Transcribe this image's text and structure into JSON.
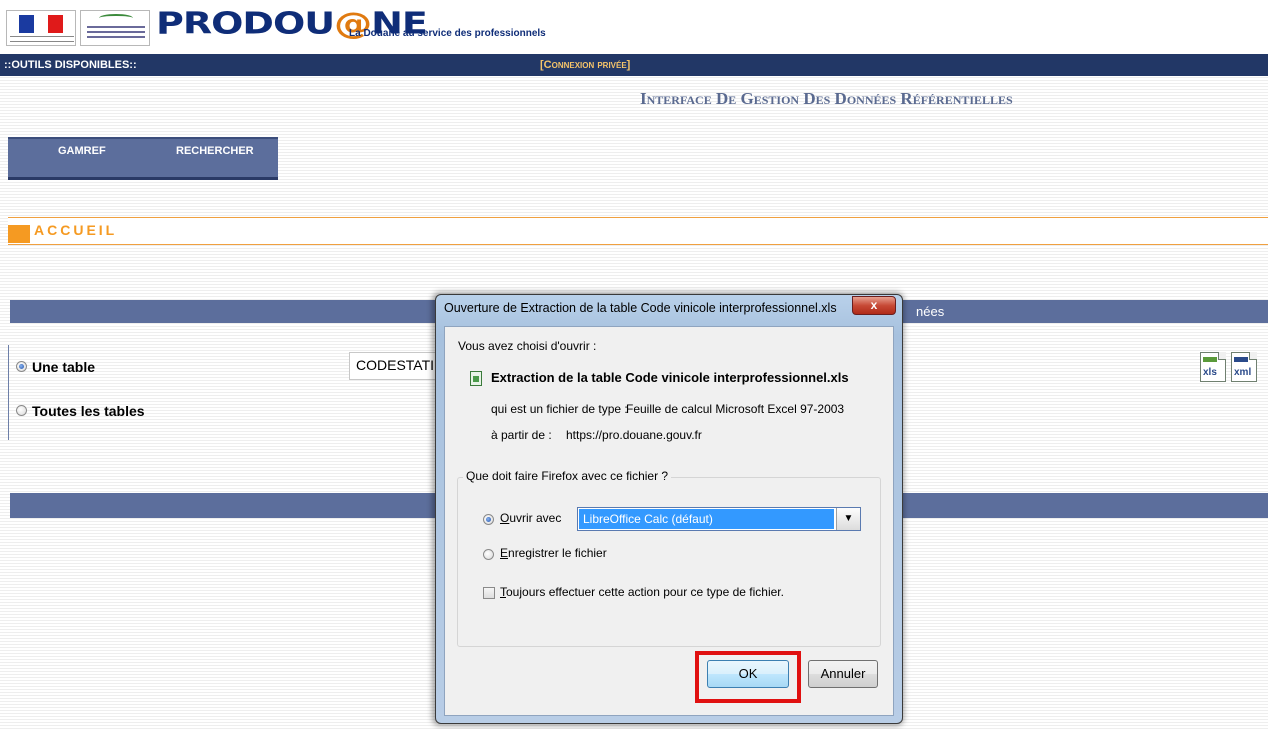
{
  "header": {
    "brand_pre": "PRODOU",
    "brand_at": "@",
    "brand_post": "NE",
    "tagline": "La Douane au service des professionnels",
    "logo_rf_icon": "republique-francaise-logo",
    "logo_ministry_icon": "ministry-logo"
  },
  "topbar": {
    "tools_label": "::OUTILS DISPONIBLES::",
    "private_link": "[Connexion privée]"
  },
  "page_title": "Interface De Gestion Des Données Référentielles",
  "menu": {
    "items": [
      {
        "label": "GAMREF"
      },
      {
        "label": "RECHERCHER"
      }
    ]
  },
  "accueil": {
    "title": "ACCUEIL"
  },
  "section1": {
    "header_visible": "nées",
    "options": [
      {
        "label": "Une table",
        "checked": true
      },
      {
        "label": "Toutes les tables",
        "checked": false
      }
    ],
    "table_value": "CODESTATI",
    "export_icons": [
      {
        "name": "xls-export-icon",
        "text": "xls"
      },
      {
        "name": "xml-export-icon",
        "text": "xml"
      }
    ]
  },
  "dialog": {
    "title": "Ouverture de Extraction de la table Code vinicole interprofessionnel.xls",
    "close_label": "x",
    "chosen_text": "Vous avez choisi d'ouvrir :",
    "file_name": "Extraction de la table Code vinicole interprofessionnel.xls",
    "type_label": "qui est un fichier de type :",
    "type_value": "Feuille de calcul Microsoft Excel 97-2003",
    "source_label": "à partir de :",
    "source_value": "https://pro.douane.gouv.fr",
    "group_legend": "Que doit faire Firefox avec ce fichier ?",
    "open_with": {
      "mnemonic": "O",
      "rest": "uvrir avec",
      "checked": true
    },
    "app_selected": "LibreOffice Calc (défaut)",
    "save_file": {
      "mnemonic": "E",
      "rest": "nregistrer le fichier",
      "checked": false
    },
    "always": {
      "mnemonic": "T",
      "rest": "oujours effectuer cette action pour ce type de fichier.",
      "checked": false
    },
    "ok_label": "OK",
    "cancel_label": "Annuler"
  },
  "colors": {
    "navy": "#223766",
    "section_blue": "#5c6e9c",
    "accent_orange": "#f59a22",
    "highlight_red": "#e01010",
    "select_blue": "#3399ff"
  }
}
